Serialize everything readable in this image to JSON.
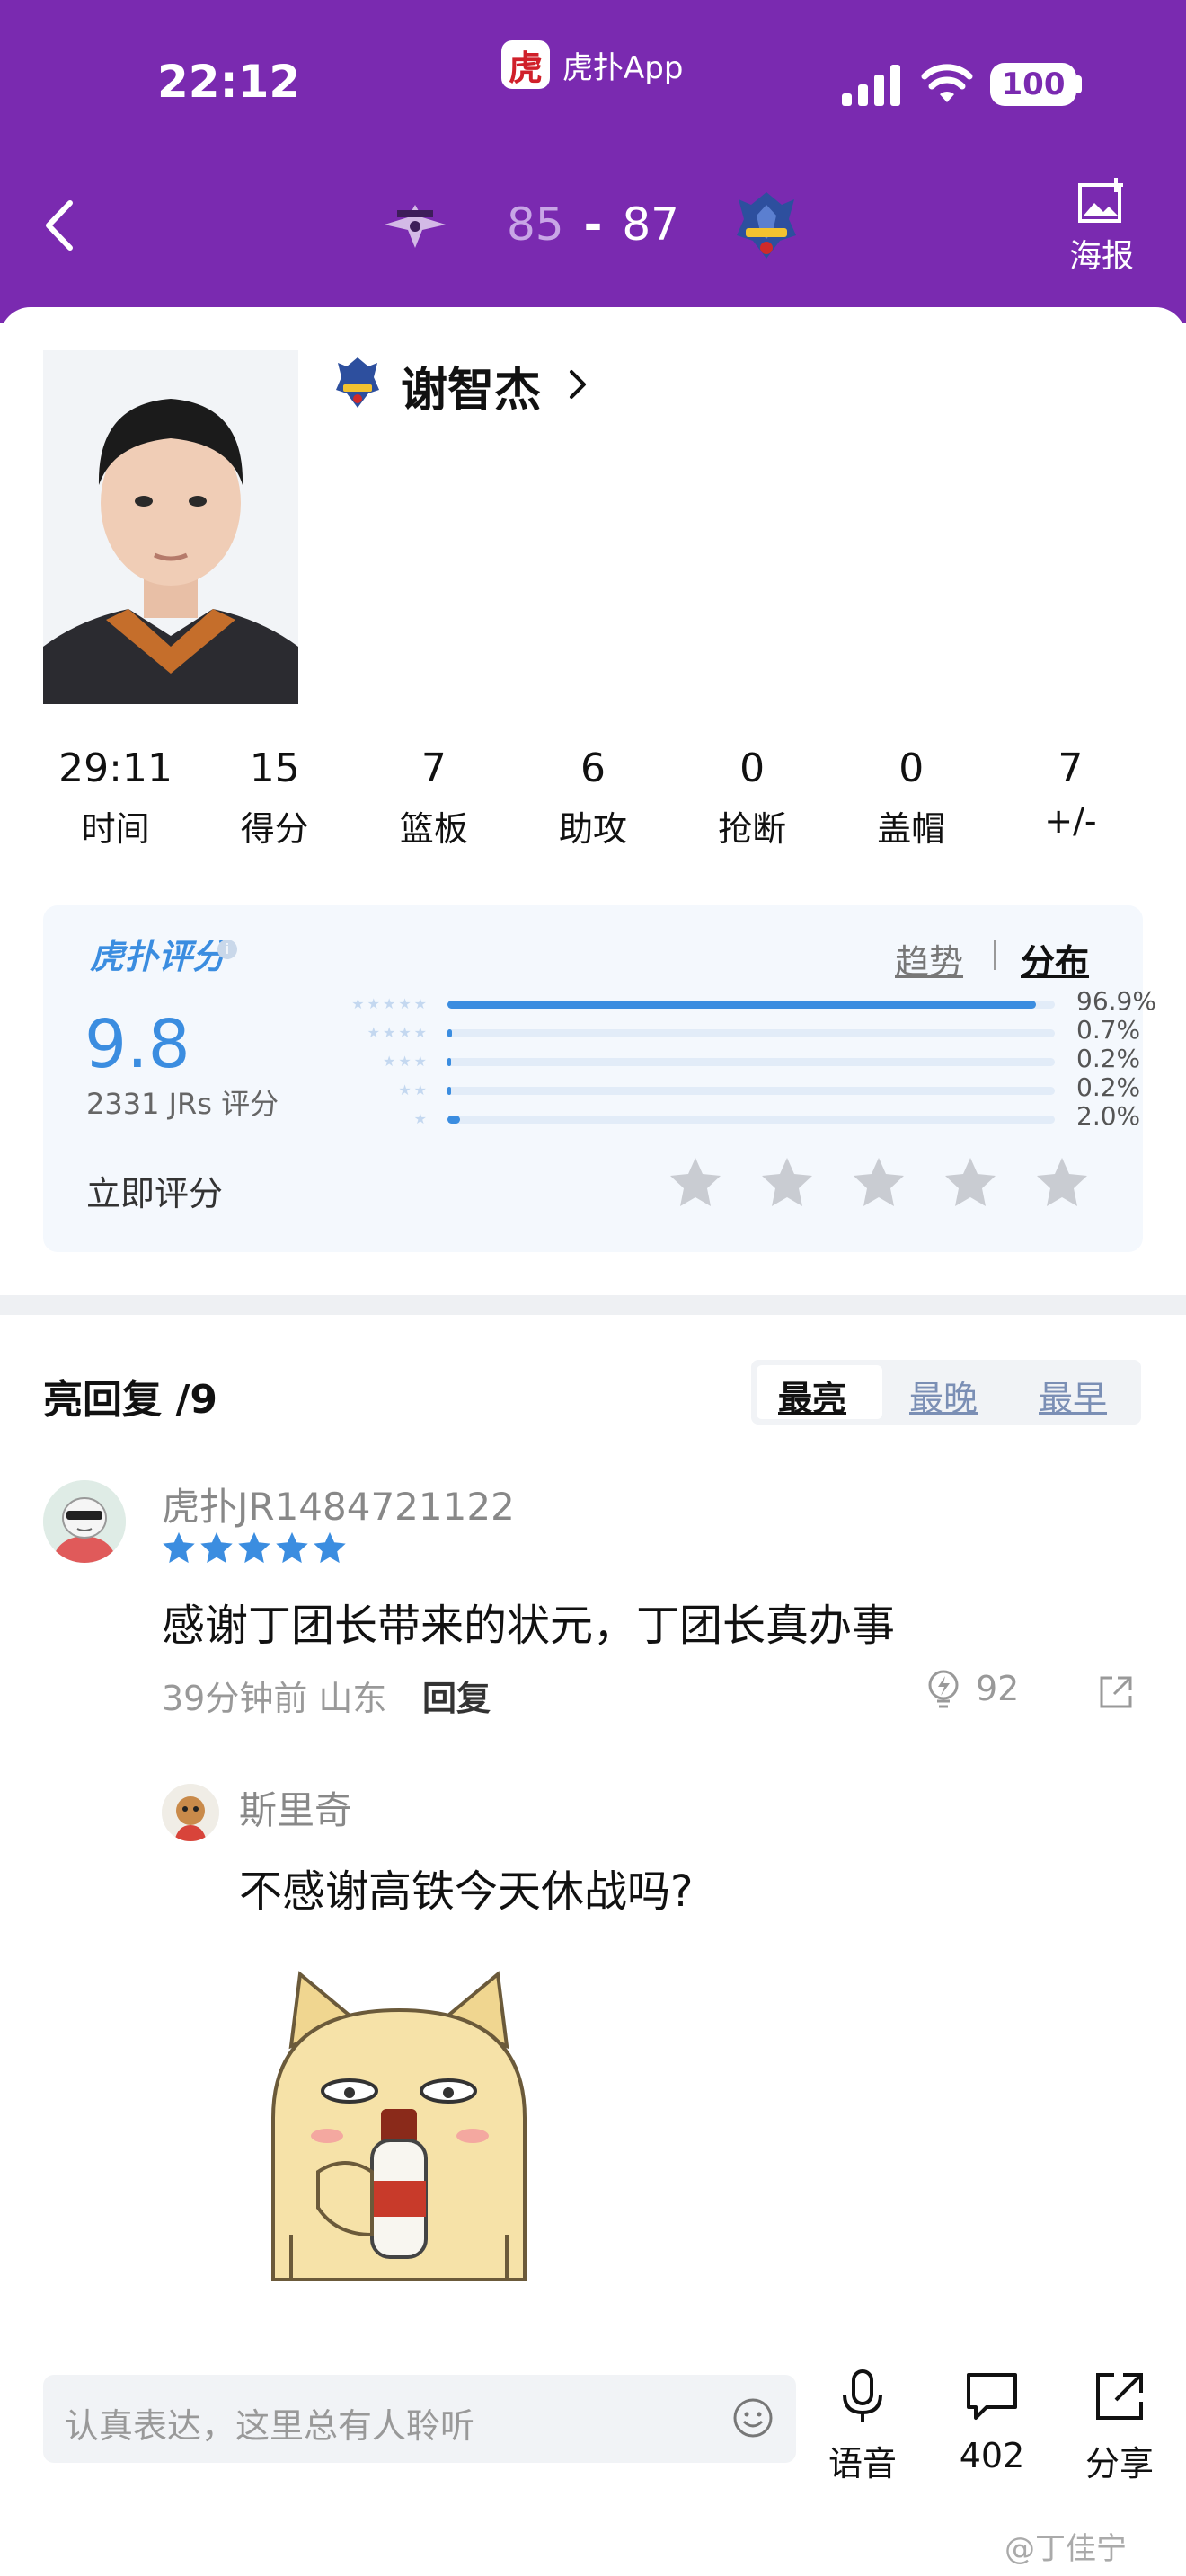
{
  "status_bar": {
    "time": "22:12",
    "app_name": "虎扑App",
    "app_logo_char": "虎",
    "battery": "100"
  },
  "header": {
    "score_home": "85",
    "score_separator": "-",
    "score_away": "87",
    "poster_label": "海报",
    "colors": {
      "background": "#7a2ab0",
      "home_score": "#c8a6e6"
    }
  },
  "player": {
    "name": "谢智杰",
    "stats": [
      {
        "value": "29:11",
        "label": "时间"
      },
      {
        "value": "15",
        "label": "得分"
      },
      {
        "value": "7",
        "label": "篮板"
      },
      {
        "value": "6",
        "label": "助攻"
      },
      {
        "value": "0",
        "label": "抢断"
      },
      {
        "value": "0",
        "label": "盖帽"
      },
      {
        "value": "7",
        "label": "+/-"
      }
    ]
  },
  "rating": {
    "brand": "虎扑评分",
    "score": "9.8",
    "count_text": "2331 JRs 评分",
    "tabs": [
      "趋势",
      "分布"
    ],
    "selected_tab": "分布",
    "distribution": [
      {
        "stars": 5,
        "percent": 96.9,
        "label": "96.9%"
      },
      {
        "stars": 4,
        "percent": 0.7,
        "label": "0.7%"
      },
      {
        "stars": 3,
        "percent": 0.2,
        "label": "0.2%"
      },
      {
        "stars": 2,
        "percent": 0.2,
        "label": "0.2%"
      },
      {
        "stars": 1,
        "percent": 2.0,
        "label": "2.0%"
      }
    ],
    "rate_now_label": "立即评分",
    "colors": {
      "accent": "#3b8de0"
    }
  },
  "replies": {
    "title": "亮回复 /9",
    "sort_options": [
      "最亮",
      "最晚",
      "最早"
    ],
    "selected_sort": "最亮",
    "comment": {
      "user": "虎扑JR1484721122",
      "stars": 5,
      "text": "感谢丁团长带来的状元，丁团长真办事",
      "meta": "39分钟前 山东",
      "reply_label": "回复",
      "likes": "92"
    },
    "reply": {
      "user": "斯里奇",
      "text": "不感谢高铁今天休战吗?"
    }
  },
  "bottom_bar": {
    "input_placeholder": "认真表达，这里总有人聆听",
    "voice_label": "语音",
    "comment_count": "402",
    "share_label": "分享"
  },
  "watermark": "@丁佳宁"
}
